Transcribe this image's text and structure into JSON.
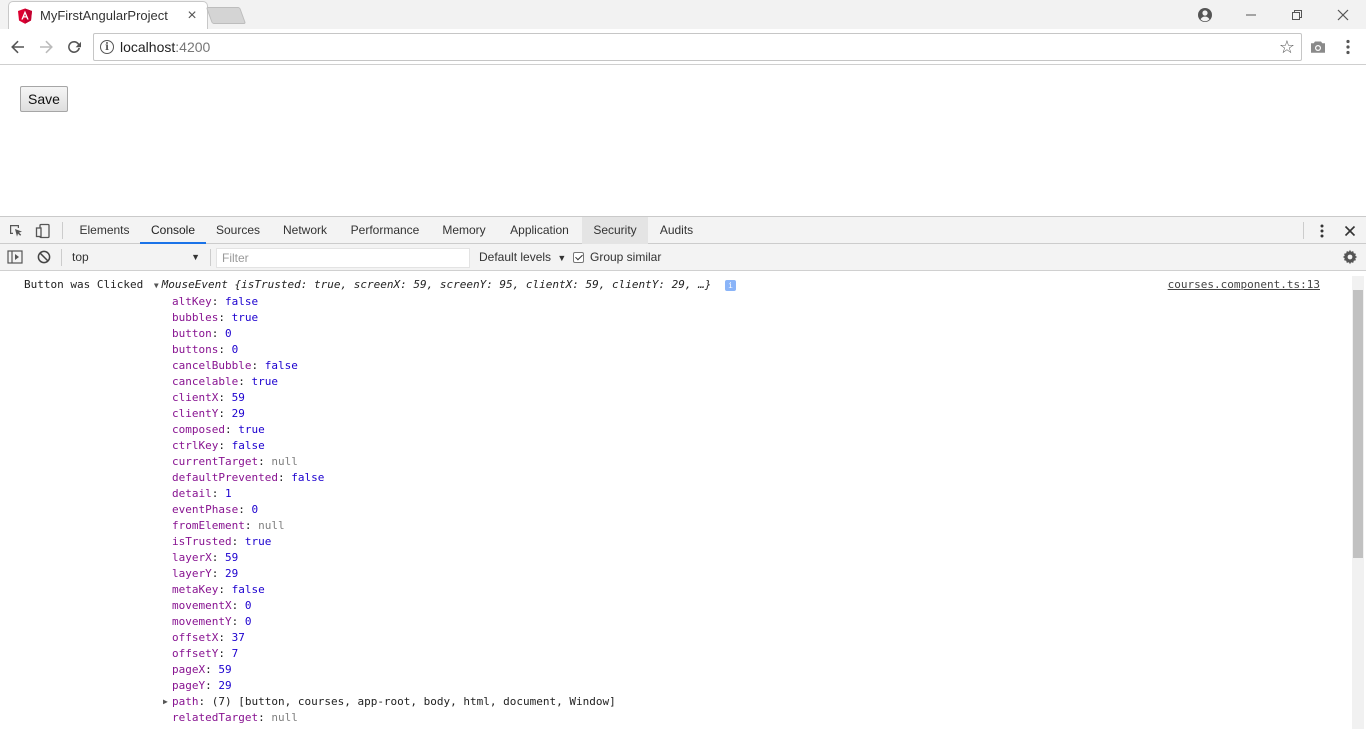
{
  "browser": {
    "tab_title": "MyFirstAngularProject",
    "url_host": "localhost",
    "url_port": ":4200"
  },
  "page": {
    "save_label": "Save"
  },
  "devtools": {
    "tabs": [
      "Elements",
      "Console",
      "Sources",
      "Network",
      "Performance",
      "Memory",
      "Application",
      "Security",
      "Audits"
    ],
    "active_tab": "Console",
    "context": "top",
    "filter_placeholder": "Filter",
    "levels": "Default levels",
    "group_similar": "Group similar"
  },
  "console": {
    "message": "Button was Clicked",
    "object_type": "MouseEvent",
    "object_preview": "{isTrusted: true, screenX: 59, screenY: 95, clientX: 59, clientY: 29, …}",
    "source": "courses.component.ts:13",
    "properties": [
      {
        "key": "altKey",
        "value": "false",
        "kind": "bool"
      },
      {
        "key": "bubbles",
        "value": "true",
        "kind": "bool"
      },
      {
        "key": "button",
        "value": "0",
        "kind": "num"
      },
      {
        "key": "buttons",
        "value": "0",
        "kind": "num"
      },
      {
        "key": "cancelBubble",
        "value": "false",
        "kind": "bool"
      },
      {
        "key": "cancelable",
        "value": "true",
        "kind": "bool"
      },
      {
        "key": "clientX",
        "value": "59",
        "kind": "num"
      },
      {
        "key": "clientY",
        "value": "29",
        "kind": "num"
      },
      {
        "key": "composed",
        "value": "true",
        "kind": "bool"
      },
      {
        "key": "ctrlKey",
        "value": "false",
        "kind": "bool"
      },
      {
        "key": "currentTarget",
        "value": "null",
        "kind": "null"
      },
      {
        "key": "defaultPrevented",
        "value": "false",
        "kind": "bool"
      },
      {
        "key": "detail",
        "value": "1",
        "kind": "num"
      },
      {
        "key": "eventPhase",
        "value": "0",
        "kind": "num"
      },
      {
        "key": "fromElement",
        "value": "null",
        "kind": "null"
      },
      {
        "key": "isTrusted",
        "value": "true",
        "kind": "bool"
      },
      {
        "key": "layerX",
        "value": "59",
        "kind": "num"
      },
      {
        "key": "layerY",
        "value": "29",
        "kind": "num"
      },
      {
        "key": "metaKey",
        "value": "false",
        "kind": "bool"
      },
      {
        "key": "movementX",
        "value": "0",
        "kind": "num"
      },
      {
        "key": "movementY",
        "value": "0",
        "kind": "num"
      },
      {
        "key": "offsetX",
        "value": "37",
        "kind": "num"
      },
      {
        "key": "offsetY",
        "value": "7",
        "kind": "num"
      },
      {
        "key": "pageX",
        "value": "59",
        "kind": "num"
      },
      {
        "key": "pageY",
        "value": "29",
        "kind": "num"
      },
      {
        "key": "path",
        "value": "(7) [button, courses, app-root, body, html, document, Window]",
        "kind": "obj",
        "expandable": true
      },
      {
        "key": "relatedTarget",
        "value": "null",
        "kind": "null"
      }
    ]
  },
  "colors": {
    "angular_red": "#dd0031",
    "accent_blue": "#1a73e8",
    "prop_key": "#881391",
    "prop_value": "#1c00cf"
  }
}
